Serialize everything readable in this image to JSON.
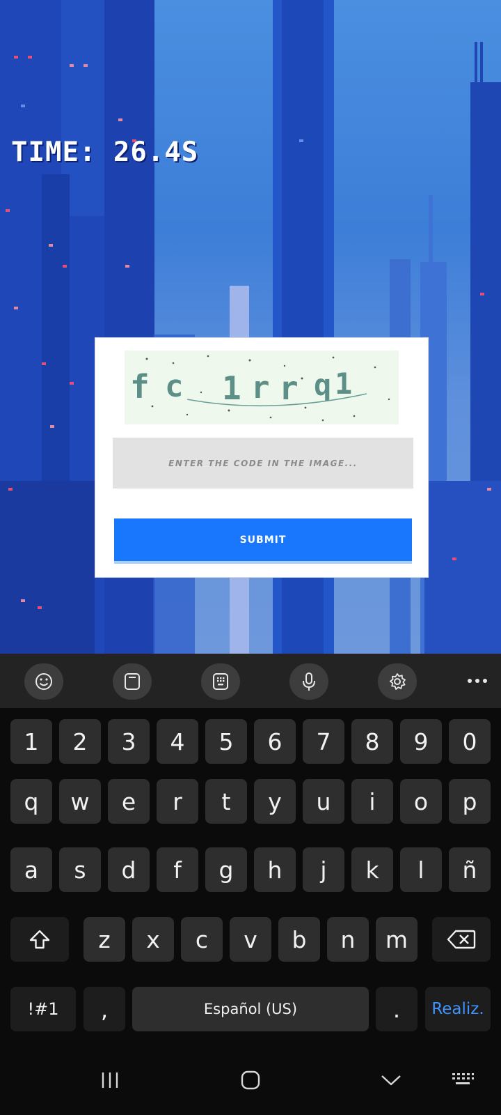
{
  "game": {
    "timer_text": "TIME: 26.4S",
    "captcha": {
      "code_chars": [
        "f",
        "c",
        "1",
        "r",
        "r",
        "q",
        "1"
      ],
      "input_placeholder": "ENTER THE CODE IN THE IMAGE...",
      "input_value": "",
      "submit_label": "SUBMIT"
    }
  },
  "keyboard": {
    "toolbar": [
      "emoji-icon",
      "clipboard-icon",
      "keypad-icon",
      "microphone-icon",
      "gear-icon",
      "more-icon"
    ],
    "rows": [
      [
        "1",
        "2",
        "3",
        "4",
        "5",
        "6",
        "7",
        "8",
        "9",
        "0"
      ],
      [
        "q",
        "w",
        "e",
        "r",
        "t",
        "y",
        "u",
        "i",
        "o",
        "p"
      ],
      [
        "a",
        "s",
        "d",
        "f",
        "g",
        "h",
        "j",
        "k",
        "l",
        "ñ"
      ],
      [
        "z",
        "x",
        "c",
        "v",
        "b",
        "n",
        "m"
      ]
    ],
    "symbols_label": "!#1",
    "comma_label": ",",
    "space_label": "Español (US)",
    "period_label": ".",
    "action_label": "Realiz.",
    "action_color": "#3f94ff"
  },
  "navbar": [
    "recent-apps-icon",
    "home-icon",
    "back-icon",
    "keyboard-switch-icon"
  ],
  "colors": {
    "submit_button": "#1877fd",
    "sky": "#4a8fe0",
    "keyboard_bg": "#0b0b0b",
    "key_bg": "#2e2e2e"
  }
}
